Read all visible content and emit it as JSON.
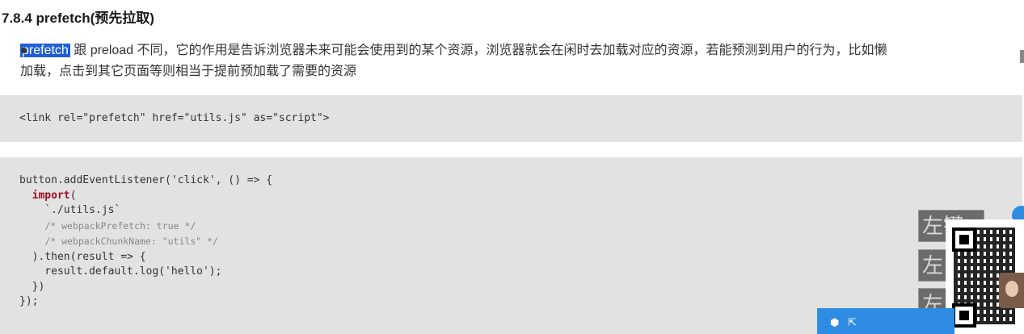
{
  "heading": "7.8.4 prefetch(预先拉取)",
  "paragraph": {
    "highlight": "prefetch",
    "line1": " 跟 preload 不同，它的作用是告诉浏览器未来可能会使用到的某个资源，浏览器就会在闲时去加载对应的资源，若能预测到用户的行为，比如懒",
    "line2": "加载，点击到其它页面等则相当于提前预加载了需要的资源"
  },
  "code_block_1": "<link rel=\"prefetch\" href=\"utils.js\" as=\"script\">",
  "code_block_2": {
    "line1": "button.addEventListener('click', () => {",
    "import_kw": "import",
    "line2_rest": "(",
    "line3": "    `./utils.js`",
    "comment1": "/* webpackPrefetch: true */",
    "comment2": "/* webpackChunkName: \"utils\" */",
    "line6": "  ).then(result => {",
    "line7": "    result.default.log('hello');",
    "line8": "  })",
    "line9": "});"
  },
  "overlay": {
    "side_button_1": "左键",
    "side_button_2": "左",
    "side_button_3": "左"
  },
  "icons": [
    "shield-icon",
    "share-icon"
  ],
  "colors": {
    "highlight": "#1f5fd6",
    "code_bg": "#e2e2e2",
    "keyword": "#a01020",
    "toolbar": "#2f8ce3"
  }
}
